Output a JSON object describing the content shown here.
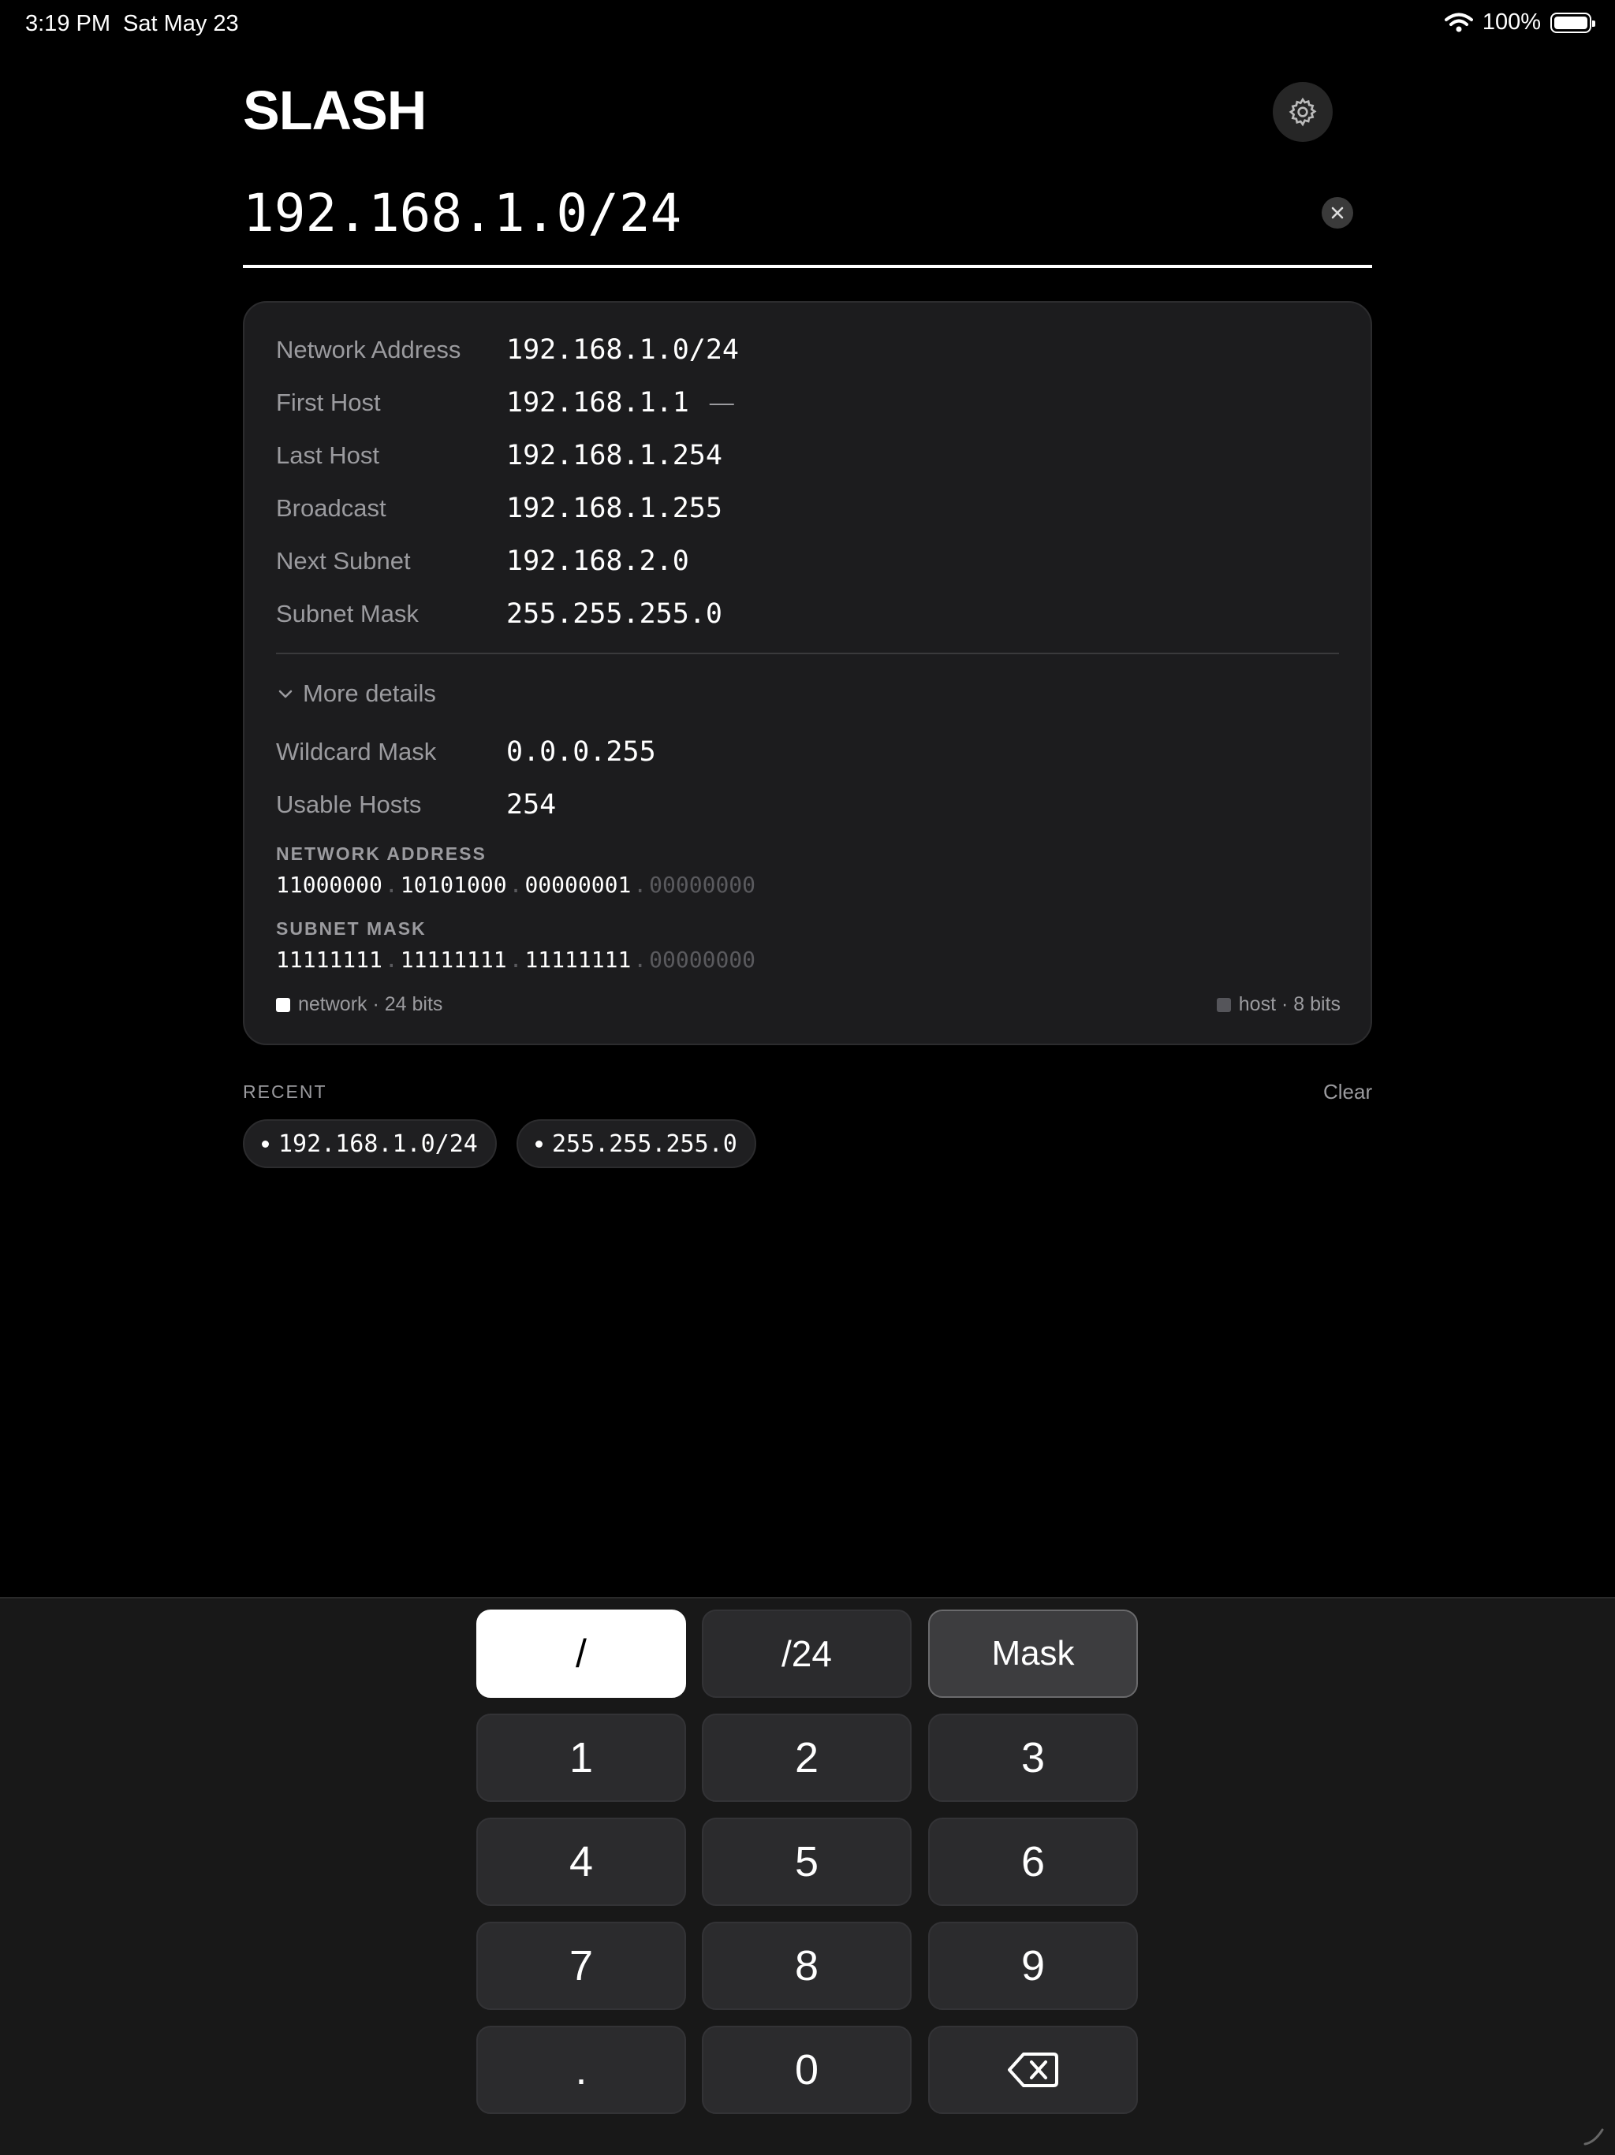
{
  "status": {
    "time": "3:19 PM",
    "date": "Sat May 23",
    "battery": "100%"
  },
  "app": {
    "title": "SLASH",
    "settings_icon": "gear-icon"
  },
  "input": {
    "value": "192.168.1.0/24",
    "clear_icon": "close-icon"
  },
  "results": {
    "rows": [
      {
        "label": "Network Address",
        "value": "192.168.1.0/24"
      },
      {
        "label": "First Host",
        "value": "192.168.1.1",
        "suffix": "—"
      },
      {
        "label": "Last Host",
        "value": "192.168.1.254"
      },
      {
        "label": "Broadcast",
        "value": "192.168.1.255"
      },
      {
        "label": "Next Subnet",
        "value": "192.168.2.0"
      },
      {
        "label": "Subnet Mask",
        "value": "255.255.255.0"
      }
    ],
    "more_details": "More details",
    "details": [
      {
        "label": "Wildcard Mask",
        "value": "0.0.0.255"
      },
      {
        "label": "Usable Hosts",
        "value": "254"
      }
    ],
    "binary": [
      {
        "label": "NETWORK ADDRESS",
        "octets": [
          "11000000",
          "10101000",
          "00000001",
          "00000000"
        ]
      },
      {
        "label": "SUBNET MASK",
        "octets": [
          "11111111",
          "11111111",
          "11111111",
          "00000000"
        ]
      }
    ],
    "separator": ".",
    "legend_network": "network · 24 bits",
    "legend_host": "host · 8 bits"
  },
  "recent": {
    "label": "RECENT",
    "clear": "Clear",
    "items": [
      "192.168.1.0/24",
      "255.255.255.0"
    ]
  },
  "keypad": {
    "top": [
      "/",
      "/24",
      "Mask"
    ],
    "digits": [
      "1",
      "2",
      "3",
      "4",
      "5",
      "6",
      "7",
      "8",
      "9"
    ],
    "bottom": [
      ".",
      "0"
    ],
    "backspace_icon": "backspace-icon"
  }
}
